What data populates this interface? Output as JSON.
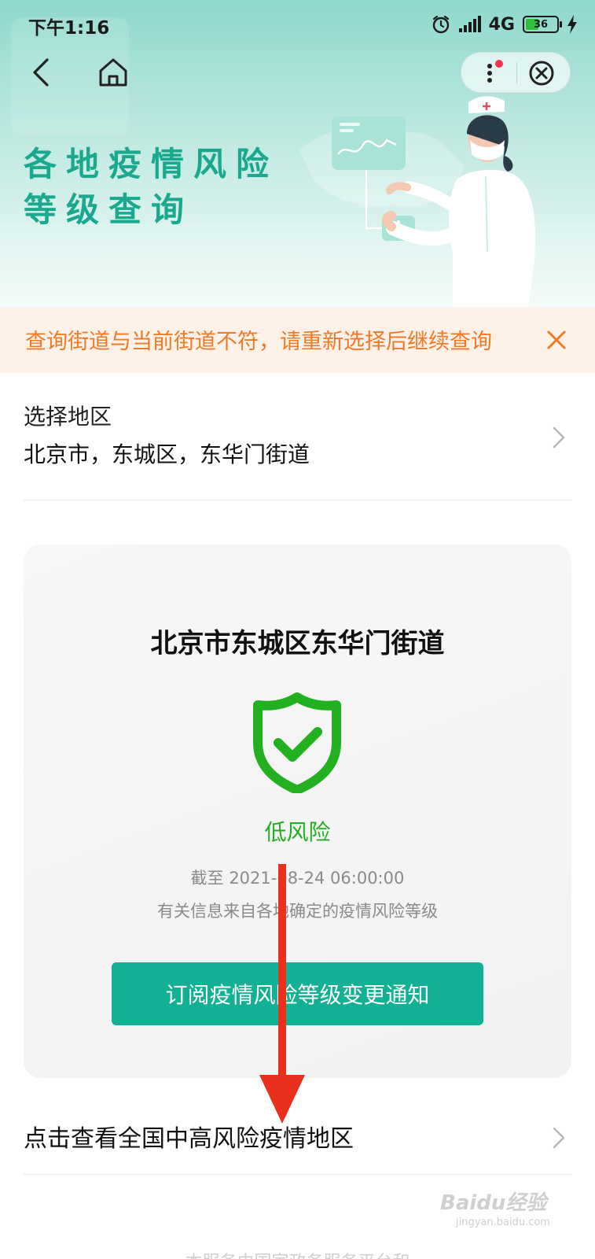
{
  "status_bar": {
    "time": "下午1:16",
    "network": "4G",
    "battery": "36"
  },
  "header": {
    "title_line1": "各地疫情风险",
    "title_line2": "等级查询"
  },
  "warning": {
    "text": "查询街道与当前街道不符，请重新选择后继续查询"
  },
  "region": {
    "label": "选择地区",
    "value": "北京市，东城区，东华门街道"
  },
  "risk_card": {
    "title": "北京市东城区东华门街道",
    "level": "低风险",
    "cutoff": "截至 2021-08-24 06:00:00",
    "source": "有关信息来自各地确定的疫情风险等级",
    "subscribe_label": "订阅疫情风险等级变更通知"
  },
  "national_link": {
    "label": "点击查看全国中高风险疫情地区"
  },
  "footer": {
    "text": "本服务由国家政务服务平台和"
  },
  "watermark": {
    "brand": "Baidu经验",
    "url": "jingyan.baidu.com"
  },
  "colors": {
    "brand_teal": "#12b094",
    "title_teal": "#1aa88f",
    "warning_orange": "#f27a27",
    "risk_green": "#22b020",
    "annotation_red": "#e8301c"
  },
  "icons": [
    "back-icon",
    "home-icon",
    "more-icon",
    "close-circle-icon",
    "close-icon",
    "chevron-right-icon",
    "shield-check-icon",
    "alarm-icon",
    "signal-icon",
    "battery-icon",
    "charging-icon"
  ]
}
